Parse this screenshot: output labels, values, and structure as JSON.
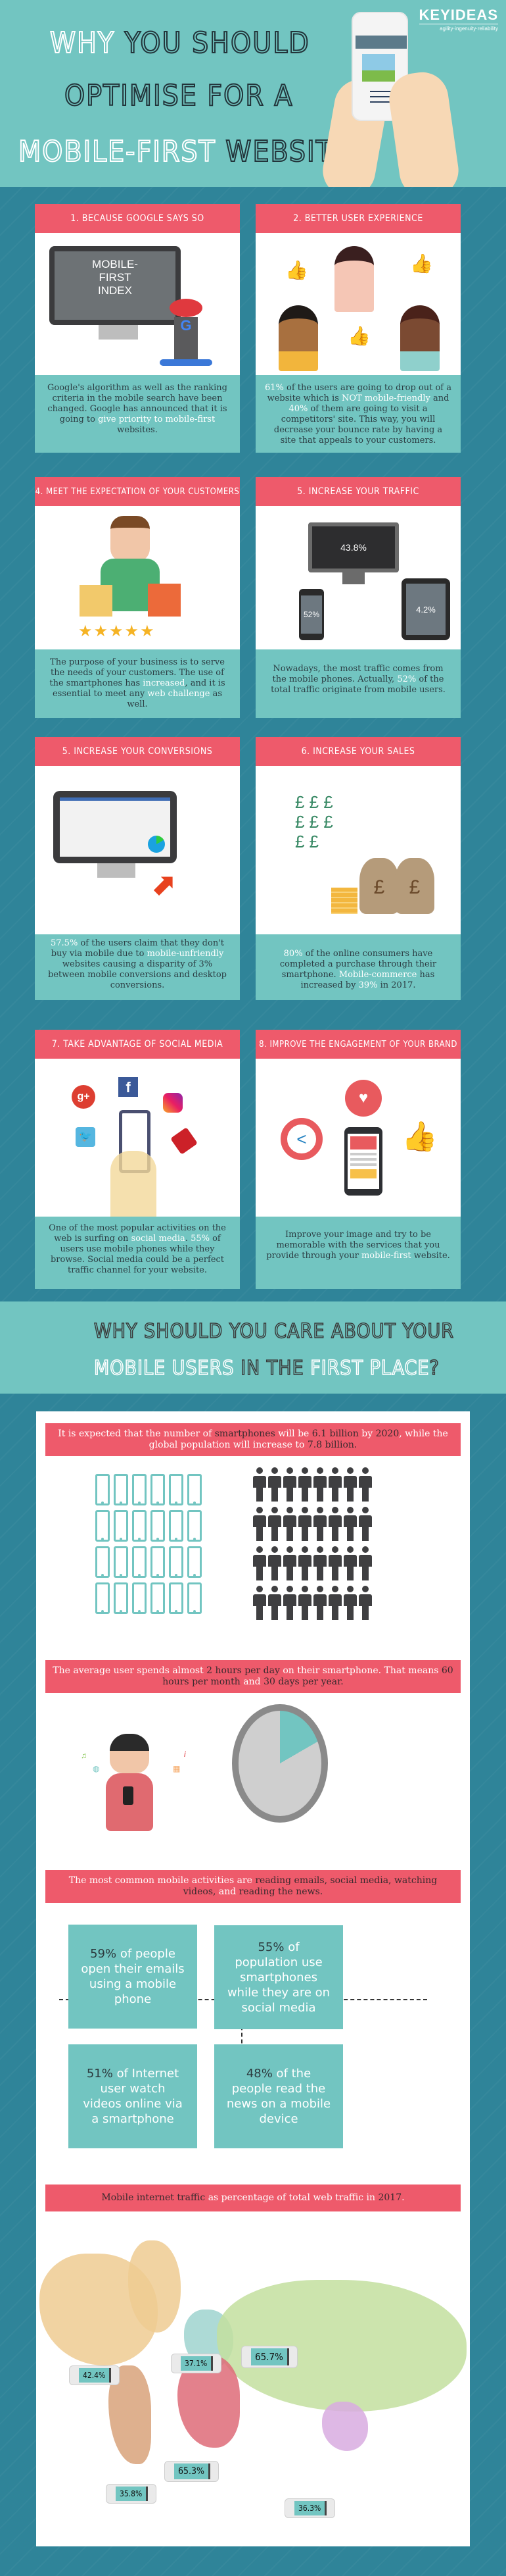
{
  "hero": {
    "line1_a": "Why",
    "line1_b": "You should",
    "line2": "Optimise for a",
    "line3_a": "Mobile-First",
    "line3_b": "Website",
    "logo_name": "KEYIDEAS",
    "logo_tagline": "agility·ingenuity·reliability"
  },
  "cards": [
    {
      "title": "1. Because Google says so",
      "illustration_text": [
        "MOBILE-",
        "FIRST",
        "INDEX"
      ],
      "text_before": "Google's algorithm as well as the ranking criteria in the mobile search have been changed. Google has announced that it is going to ",
      "text_hl": "give priority to mobile-first",
      "text_after": " websites."
    },
    {
      "title": "2. Better User Experience",
      "hl1": "61%",
      "t1": " of the users are going to drop out of a website which is ",
      "hl2": "NOT mobile-friendly",
      "t2": " and ",
      "hl3": "40%",
      "t3": " of them are going to visit a competitors' site. This way, you will decrease your bounce rate by having a site that appeals to your customers."
    },
    {
      "title": "4. Meet the expectation of your customers",
      "rating_stars": 5,
      "t1": "The purpose of your business is to serve the needs of your customers. The use of the smartphones has ",
      "hl1": "increased",
      "t2": ", and it is essential to meet any ",
      "hl2": "web challenge",
      "t3": " as well."
    },
    {
      "title": "5. Increase your traffic",
      "desktop_pct": "43.8%",
      "mobile_pct": "52%",
      "tablet_pct": "4.2%",
      "t1": "Nowadays, the most traffic comes from the mobile phones. Actually, ",
      "hl1": "52%",
      "t2": " of the total traffic originate from mobile users."
    },
    {
      "title": "5. Increase your conversions",
      "hl1": "57.5%",
      "t1": " of the users claim that they don't buy via mobile due to ",
      "hl2": "mobile-unfriendly",
      "t2": " websites causing a disparity of 3% between mobile conversions and desktop conversions."
    },
    {
      "title": "6. Increase your sales",
      "hl1": "80%",
      "t1": " of the online consumers have completed a purchase through their smartphone. ",
      "hl2": "Mobile-commerce",
      "t2": " has increased by ",
      "hl3": "39%",
      "t3": " in 2017."
    },
    {
      "title": "7. Take advantage of social media",
      "t1": "One of the most popular activities on the web is surfing on ",
      "hl1": "social media",
      "t2": ". ",
      "hl2": "55%",
      "t3": " of users use mobile phones while they browse. Social media could be a perfect traffic channel for your website."
    },
    {
      "title": "8. Improve the engagement of your brand",
      "t1": "Improve your image and try to be memorable with the services that you provide through your ",
      "hl1": "mobile-first",
      "t2": " website."
    }
  ],
  "section2": {
    "line1": "Why should you care about your",
    "line2_a": "Mobile users",
    "line2_b": "in the",
    "line2_c": "first place",
    "line2_d": "?"
  },
  "facts": {
    "smartphones": {
      "t1": "It is expected that the number of ",
      "d1": "smartphones",
      "t2": " will be ",
      "d2": "6.1 billion",
      "t3": " by ",
      "d3": "2020",
      "t4": ", while the global population will increase to ",
      "d4": "7.8 billion."
    },
    "time": {
      "t1": "The average user spends almost ",
      "d1": "2 hours per day",
      "t2": " on their smartphone. That means ",
      "d2": "60 hours per month",
      "t3": " and ",
      "d3": "30 days per year."
    },
    "activities": {
      "t1": "The most common mobile activities are ",
      "d1": "reading emails, social media, watching videos,",
      "t2": " and ",
      "d2": "reading the news."
    },
    "stats": [
      {
        "num": "59%",
        "text": " of people open their emails using a mobile phone"
      },
      {
        "num": "55%",
        "text": " of population use smartphones while they are on social media"
      },
      {
        "num": "51%",
        "text": " of Internet user watch videos online via a smartphone"
      },
      {
        "num": "48%",
        "text": " of the people read the news on a mobile device"
      }
    ],
    "map_title": {
      "d1": "Mobile internet traffic",
      "t1": " as percentage of total web traffic in ",
      "d2": "2017",
      "t2": "."
    },
    "map_values": [
      {
        "region": "North America",
        "value": "42.4%",
        "color": "#eecb92"
      },
      {
        "region": "Europe",
        "value": "37.1%",
        "color": "#9fd3cf"
      },
      {
        "region": "Asia",
        "value": "65.7%",
        "color": "#c3df9f"
      },
      {
        "region": "Africa",
        "value": "65.3%",
        "color": "#de6b78"
      },
      {
        "region": "South America",
        "value": "35.8%",
        "color": "#d8a27a"
      },
      {
        "region": "Oceania",
        "value": "36.3%",
        "color": "#d8abe0"
      }
    ]
  }
}
